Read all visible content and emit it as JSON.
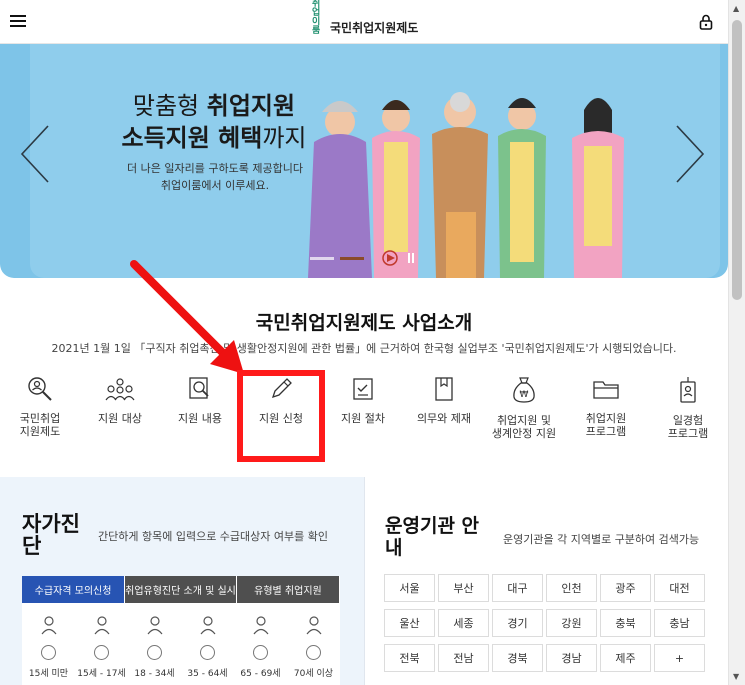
{
  "header": {
    "logo_mark": "취업\n이룸",
    "logo_text": "국민취업지원제도"
  },
  "banner": {
    "title_line1_plain": "맞춤형 ",
    "title_line1_bold": "취업지원",
    "title_line2_bold": "소득지원 혜택",
    "title_line2_plain": "까지",
    "sub_line1": "더 나은 일자리를 구하도록 제공합니다",
    "sub_line2": "취업이룸에서 이루세요."
  },
  "section": {
    "title": "국민취업지원제도 사업소개",
    "desc": "2021년 1월 1일 「구직자 취업촉진 및 생활안정지원에 관한 법률」에 근거하여 한국형 실업부조 '국민취업지원제도'가 시행되었습니다."
  },
  "icons": [
    {
      "label": "국민취업\n지원제도",
      "icon": "search-person-icon"
    },
    {
      "label": "지원 대상",
      "icon": "people-group-icon"
    },
    {
      "label": "지원 내용",
      "icon": "document-search-icon"
    },
    {
      "label": "지원 신청",
      "icon": "pencil-icon"
    },
    {
      "label": "지원 절차",
      "icon": "checklist-icon"
    },
    {
      "label": "의무와 제재",
      "icon": "book-icon"
    },
    {
      "label": "취업지원 및\n생계안정 지원",
      "icon": "money-bag-icon"
    },
    {
      "label": "취업지원\n프로그램",
      "icon": "folder-icon"
    },
    {
      "label": "일경험\n프로그램",
      "icon": "tag-person-icon"
    }
  ],
  "self_diagnosis": {
    "title": "자가진단",
    "desc": "간단하게 항목에 입력으로 수급대상자 여부를 확인",
    "tabs": [
      "수급자격 모의신청",
      "취업유형진단 소개 및 실시",
      "유형별 취업지원"
    ],
    "ages": [
      "15세 미만",
      "15세 - 17세",
      "18 - 34세",
      "35 - 64세",
      "65 - 69세",
      "70세 이상"
    ]
  },
  "organizations": {
    "title": "운영기관 안내",
    "desc": "운영기관을 각 지역별로 구분하여 검색가능",
    "regions": [
      "서울",
      "부산",
      "대구",
      "인천",
      "광주",
      "대전",
      "울산",
      "세종",
      "경기",
      "강원",
      "충북",
      "충남",
      "전북",
      "전남",
      "경북",
      "경남",
      "제주",
      "+"
    ]
  },
  "colors": {
    "banner_bg": "#7ec4e8",
    "tab_active": "#2754b3",
    "highlight": "#ff1a1a"
  }
}
